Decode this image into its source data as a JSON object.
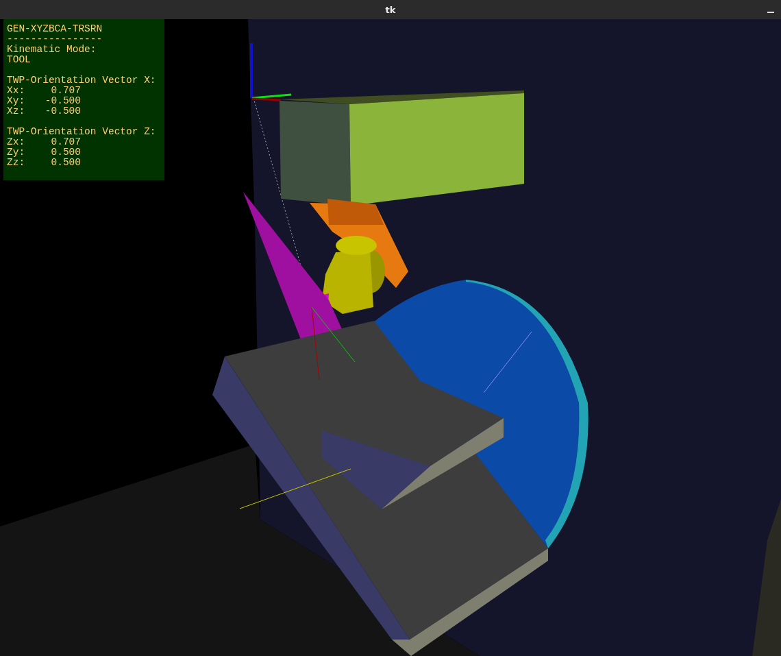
{
  "window": {
    "title": "tk"
  },
  "overlay": {
    "machine": "GEN-XYZBCA-TRSRN",
    "separator": "----------------",
    "mode_label": "Kinematic Mode:",
    "mode": "TOOL",
    "vectors": [
      {
        "heading": "TWP-Orientation Vector X:",
        "components": [
          {
            "label": "Xx:",
            "value": "0.707"
          },
          {
            "label": "Xy:",
            "value": "-0.500"
          },
          {
            "label": "Xz:",
            "value": "-0.500"
          }
        ]
      },
      {
        "heading": "TWP-Orientation Vector Z:",
        "components": [
          {
            "label": "Zx:",
            "value": "0.707"
          },
          {
            "label": "Zy:",
            "value": "0.500"
          },
          {
            "label": "Zz:",
            "value": "0.500"
          }
        ]
      }
    ]
  }
}
